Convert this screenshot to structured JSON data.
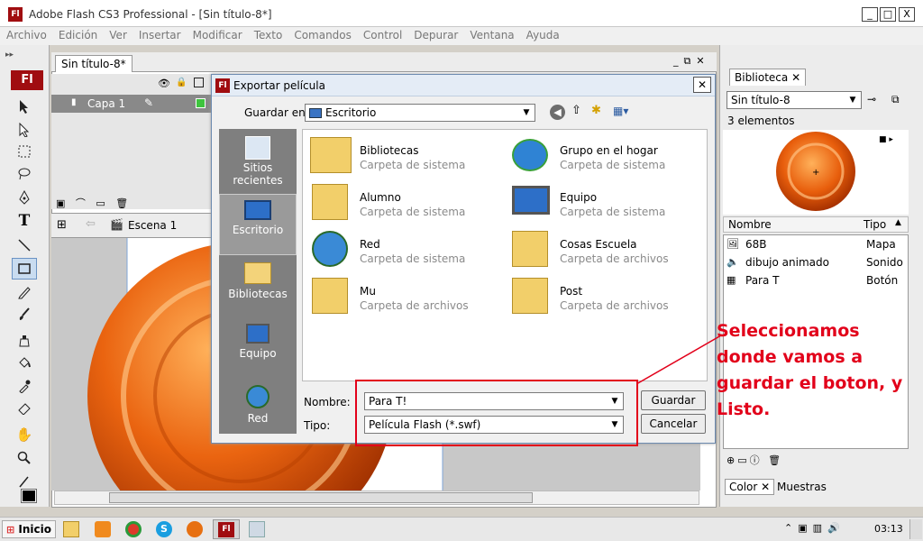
{
  "app": {
    "icon": "Fl",
    "title": "Adobe Flash CS3 Professional - [Sin título-8*]"
  },
  "window_buttons": {
    "minimize": "_",
    "maximize": "□",
    "close": "X"
  },
  "menu": [
    "Archivo",
    "Edición",
    "Ver",
    "Insertar",
    "Modificar",
    "Texto",
    "Comandos",
    "Control",
    "Depurar",
    "Ventana",
    "Ayuda"
  ],
  "tools_header": "Fl",
  "document": {
    "tab": "Sin título-8*",
    "layer_name": "Capa 1",
    "scene": "Escena 1"
  },
  "dialog": {
    "icon": "Fl",
    "title": "Exportar película",
    "save_in_label": "Guardar en:",
    "save_in_value": "Escritorio",
    "places": [
      {
        "label": "Sitios recientes",
        "icon": "recent-places-icon"
      },
      {
        "label": "Escritorio",
        "icon": "desktop-icon"
      },
      {
        "label": "Bibliotecas",
        "icon": "libraries-icon"
      },
      {
        "label": "Equipo",
        "icon": "computer-icon"
      },
      {
        "label": "Red",
        "icon": "network-icon"
      }
    ],
    "files": [
      {
        "name": "Bibliotecas",
        "type": "Carpeta de sistema",
        "icon": "libraries-folder-icon"
      },
      {
        "name": "Grupo en el hogar",
        "type": "Carpeta de sistema",
        "icon": "homegroup-icon"
      },
      {
        "name": "Alumno",
        "type": "Carpeta de sistema",
        "icon": "user-folder-icon"
      },
      {
        "name": "Equipo",
        "type": "Carpeta de sistema",
        "icon": "computer-icon"
      },
      {
        "name": "Red",
        "type": "Carpeta de sistema",
        "icon": "network-icon"
      },
      {
        "name": "Cosas Escuela",
        "type": "Carpeta de archivos",
        "icon": "folder-icon"
      },
      {
        "name": "Mu",
        "type": "Carpeta de archivos",
        "icon": "folder-icon"
      },
      {
        "name": "Post",
        "type": "Carpeta de archivos",
        "icon": "folder-icon"
      }
    ],
    "name_label": "Nombre:",
    "name_value": "Para T!",
    "type_label": "Tipo:",
    "type_value": "Película Flash (*.swf)",
    "save_button": "Guardar",
    "cancel_button": "Cancelar"
  },
  "library": {
    "tab": "Biblioteca",
    "document": "Sin título-8",
    "count": "3 elementos",
    "col_name": "Nombre",
    "col_type": "Tipo",
    "items": [
      {
        "name": "68B",
        "type": "Mapa"
      },
      {
        "name": "dibujo animado",
        "type": "Sonido"
      },
      {
        "name": "Para T",
        "type": "Botón"
      }
    ]
  },
  "bottom_panels": {
    "color_tab": "Color",
    "swatches_tab": "Muestras"
  },
  "annotation": "Seleccionamos donde vamos a guardar el boton, y Listo.",
  "taskbar": {
    "start": "Inicio",
    "clock": "03:13"
  },
  "colors": {
    "accent_red": "#e2001a",
    "flash_red": "#a00d10",
    "button_orange": "#e05a0a"
  }
}
